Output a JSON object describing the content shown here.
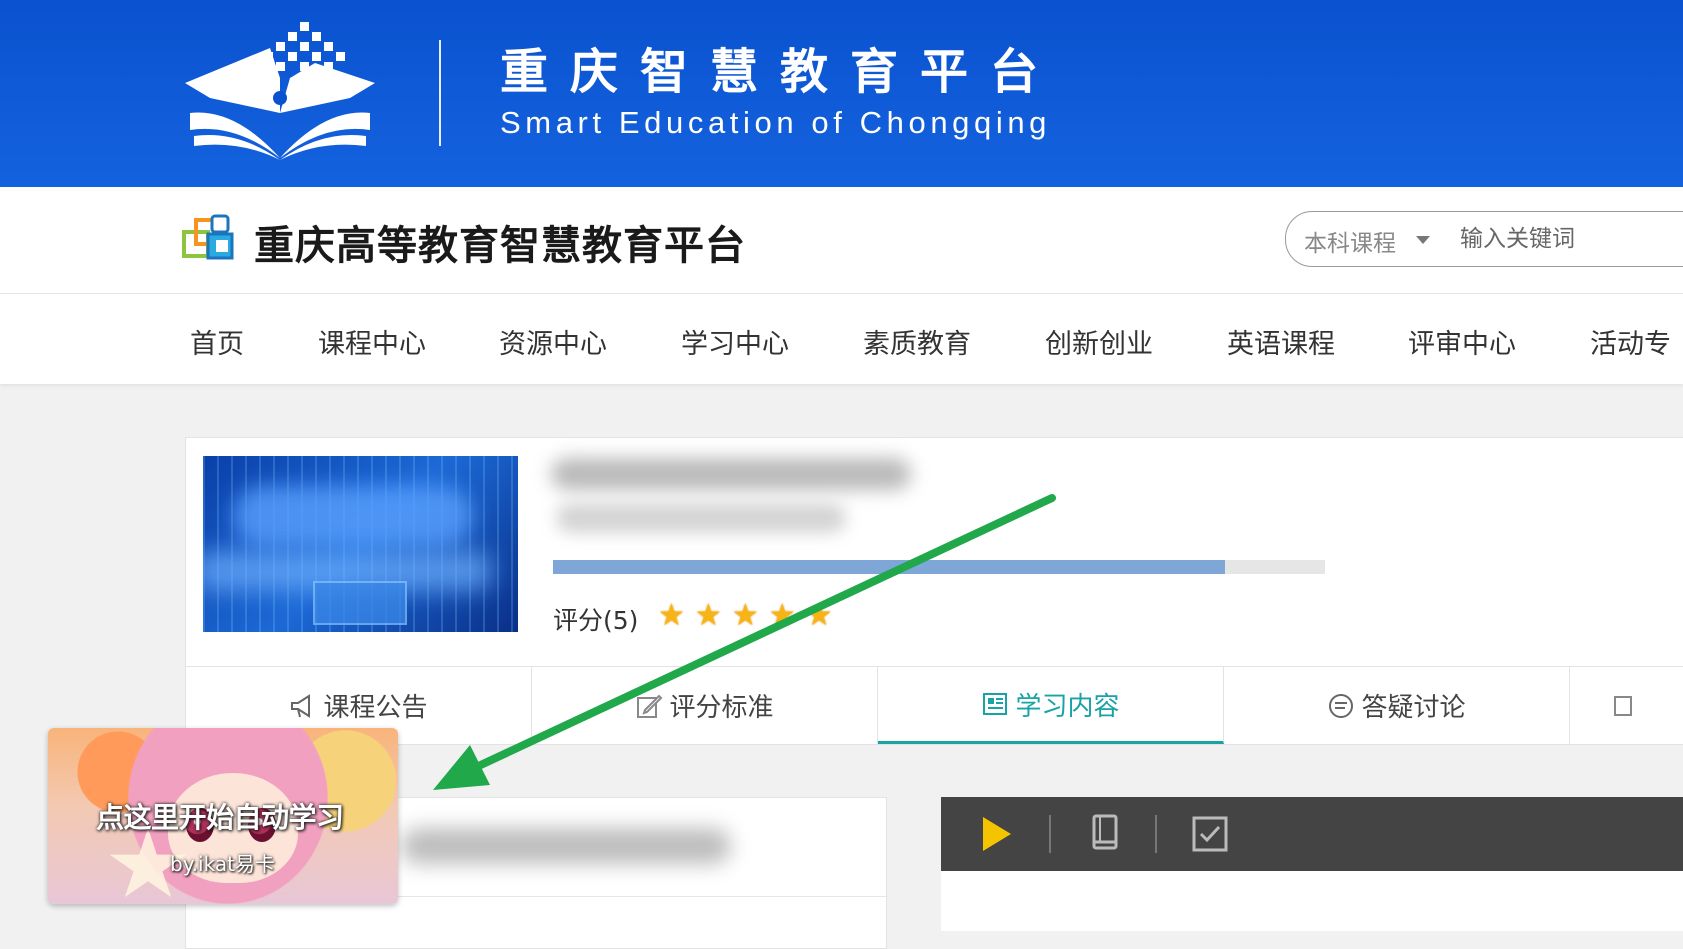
{
  "banner": {
    "title": "重庆智慧教育平台",
    "subtitle": "Smart Education of Chongqing"
  },
  "header": {
    "site_name": "重庆高等教育智慧教育平台",
    "search": {
      "type_selected": "本科课程",
      "placeholder": "输入关键词"
    }
  },
  "nav": {
    "items": [
      {
        "label": "首页"
      },
      {
        "label": "课程中心"
      },
      {
        "label": "资源中心"
      },
      {
        "label": "学习中心"
      },
      {
        "label": "素质教育"
      },
      {
        "label": "创新创业"
      },
      {
        "label": "英语课程"
      },
      {
        "label": "评审中心"
      },
      {
        "label": "活动专"
      }
    ]
  },
  "course": {
    "progress_fraction": 0.87,
    "rating_label": "评分(5)",
    "stars": 5
  },
  "tabs": [
    {
      "label": "课程公告",
      "icon": "megaphone-icon",
      "active": false
    },
    {
      "label": "评分标准",
      "icon": "edit-icon",
      "active": false
    },
    {
      "label": "学习内容",
      "icon": "content-icon",
      "active": true
    },
    {
      "label": "答疑讨论",
      "icon": "chat-icon",
      "active": false
    }
  ],
  "player": {
    "icons": [
      "play-icon",
      "book-icon",
      "checkbox-icon"
    ]
  },
  "widget": {
    "text": "点这里开始自动学习",
    "credit": "by.ikat易卡"
  },
  "colors": {
    "banner_blue": "#0a52cf",
    "accent_teal": "#1aa3a7",
    "progress_blue": "#7ea7d8",
    "star_yellow": "#f7b415",
    "arrow_green": "#20a84a",
    "play_yellow": "#f5c400"
  }
}
